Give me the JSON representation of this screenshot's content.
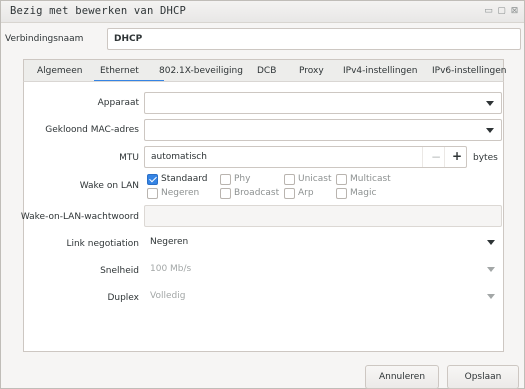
{
  "window": {
    "title": "Bezig met bewerken van DHCP"
  },
  "connection": {
    "label": "Verbindingsnaam",
    "value": "DHCP"
  },
  "tabs": [
    {
      "label": "Algemeen"
    },
    {
      "label": "Ethernet"
    },
    {
      "label": "802.1X-beveiliging"
    },
    {
      "label": "DCB"
    },
    {
      "label": "Proxy"
    },
    {
      "label": "IPv4-instellingen"
    },
    {
      "label": "IPv6-instellingen"
    }
  ],
  "active_tab": "Ethernet",
  "form": {
    "device": {
      "label": "Apparaat",
      "value": ""
    },
    "cloned_mac": {
      "label": "Gekloond MAC-adres",
      "value": ""
    },
    "mtu": {
      "label": "MTU",
      "value": "automatisch",
      "minus": "−",
      "plus": "+",
      "unit": "bytes"
    },
    "wake_on_lan": {
      "label": "Wake on LAN",
      "options": [
        {
          "label": "Standaard",
          "checked": true
        },
        {
          "label": "Phy",
          "checked": false
        },
        {
          "label": "Unicast",
          "checked": false
        },
        {
          "label": "Multicast",
          "checked": false
        },
        {
          "label": "Negeren",
          "checked": false
        },
        {
          "label": "Broadcast",
          "checked": false
        },
        {
          "label": "Arp",
          "checked": false
        },
        {
          "label": "Magic",
          "checked": false
        }
      ]
    },
    "wol_password": {
      "label": "Wake-on-LAN-wachtwoord",
      "value": ""
    },
    "link_negotiation": {
      "label": "Link negotiation",
      "value": "Negeren"
    },
    "speed": {
      "label": "Snelheid",
      "value": "100 Mb/s"
    },
    "duplex": {
      "label": "Duplex",
      "value": "Volledig"
    }
  },
  "buttons": {
    "cancel": "Annuleren",
    "save": "Opslaan"
  },
  "colors": {
    "accent": "#3584e4"
  }
}
